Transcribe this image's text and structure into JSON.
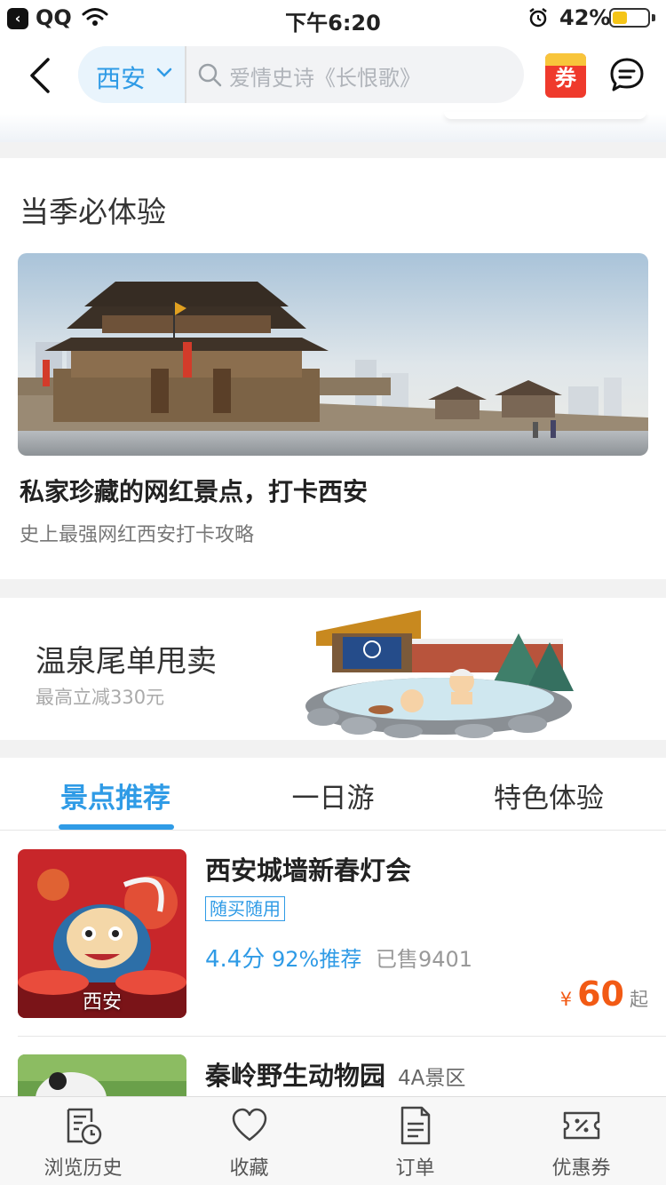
{
  "status_bar": {
    "app": "QQ",
    "time": "下午6:20",
    "battery_text": "42%",
    "battery_level": 0.42
  },
  "nav": {
    "city": "西安",
    "search_placeholder": "爱情史诗《长恨歌》",
    "coupon_badge": "券"
  },
  "season": {
    "title": "当季必体验",
    "headline": "私家珍藏的网红景点，打卡西安",
    "subtitle": "史上最强网红西安打卡攻略"
  },
  "banner": {
    "title": "温泉尾单甩卖",
    "subtitle": "最高立减330元"
  },
  "tabs": [
    {
      "label": "景点推荐"
    },
    {
      "label": "一日游"
    },
    {
      "label": "特色体验"
    }
  ],
  "items": [
    {
      "title": "西安城墙新春灯会",
      "tag": "随买随用",
      "score": "4.4分",
      "recommend": "92%推荐",
      "sold": "已售9401",
      "currency": "¥",
      "price": "60",
      "price_suffix": "起",
      "thumb_city": "西安"
    },
    {
      "title": "秦岭野生动物园",
      "level": "4A景区"
    }
  ],
  "bottom_nav": [
    {
      "label": "浏览历史",
      "icon": "history-icon"
    },
    {
      "label": "收藏",
      "icon": "heart-icon"
    },
    {
      "label": "订单",
      "icon": "order-icon"
    },
    {
      "label": "优惠券",
      "icon": "coupon-icon"
    }
  ],
  "colors": {
    "accent": "#2f9be6",
    "price": "#f25a14",
    "coupon_red": "#ef3a2c"
  }
}
